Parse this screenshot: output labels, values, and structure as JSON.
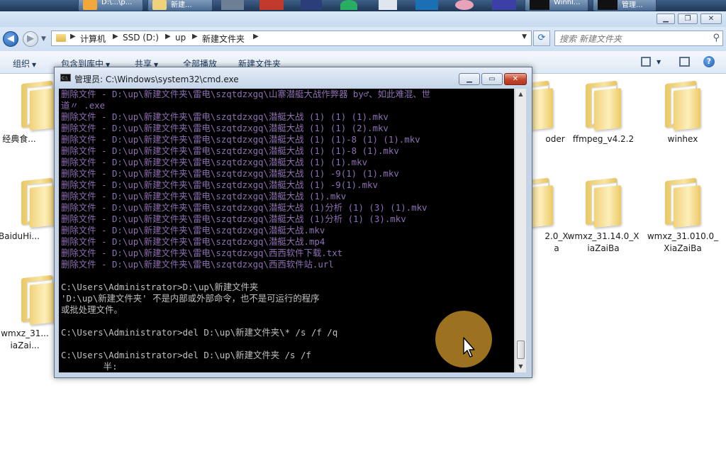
{
  "taskbar": {
    "items": [
      {
        "label": "D:\\...\\p...",
        "icon": "app-icon"
      },
      {
        "label": "新建...",
        "icon": "folder-icon"
      },
      {
        "label": "Winhl...",
        "icon": "window-icon"
      },
      {
        "label": "管理...",
        "icon": "cmd-icon"
      }
    ],
    "tray_icons": [
      "app-icon-1",
      "app-icon-2",
      "app-icon-3",
      "app-icon-4",
      "app-icon-5",
      "app-icon-6",
      "app-icon-7",
      "app-icon-8"
    ]
  },
  "explorer": {
    "breadcrumb": [
      "计算机",
      "SSD (D:)",
      "up",
      "新建文件夹"
    ],
    "search_placeholder": "搜索 新建文件夹",
    "toolbar": {
      "organize": "组织",
      "include_in_library": "包含到库中",
      "share": "共享",
      "play_all": "全部播放",
      "new_folder": "新建文件夹"
    },
    "folders": [
      {
        "label": "经典食..."
      },
      {
        "label": "BaiduHi..."
      },
      {
        "label": "wmxz_31...\niaZai..."
      },
      {
        "label": "oder"
      },
      {
        "label": "ffmpeg_v4.2.2"
      },
      {
        "label": "winhex"
      },
      {
        "label": "2.0_X\na"
      },
      {
        "label": "wmxz_31.14.0_X\niaZaiBa"
      },
      {
        "label": "wmxz_31.010.0_\nXiaZaiBa"
      }
    ]
  },
  "cmd": {
    "title": "管理员: C:\\Windows\\system32\\cmd.exe",
    "icon_text": "C:\\",
    "lines": [
      {
        "text": "删除文件 - D:\\up\\新建文件夹\\雷电\\szqtdzxgq\\山寨潜艇大战作弊器 by♂、如此难混、世",
        "type": "del"
      },
      {
        "text": "道〃 .exe",
        "type": "del"
      },
      {
        "text": "删除文件 - D:\\up\\新建文件夹\\雷电\\szqtdzxgq\\潜艇大战 (1) (1) (1).mkv",
        "type": "del"
      },
      {
        "text": "删除文件 - D:\\up\\新建文件夹\\雷电\\szqtdzxgq\\潜艇大战 (1) (1) (2).mkv",
        "type": "del"
      },
      {
        "text": "删除文件 - D:\\up\\新建文件夹\\雷电\\szqtdzxgq\\潜艇大战 (1) (1)-8 (1) (1).mkv",
        "type": "del"
      },
      {
        "text": "删除文件 - D:\\up\\新建文件夹\\雷电\\szqtdzxgq\\潜艇大战 (1) (1)-8 (1).mkv",
        "type": "del"
      },
      {
        "text": "删除文件 - D:\\up\\新建文件夹\\雷电\\szqtdzxgq\\潜艇大战 (1) (1).mkv",
        "type": "del"
      },
      {
        "text": "删除文件 - D:\\up\\新建文件夹\\雷电\\szqtdzxgq\\潜艇大战 (1) -9(1) (1).mkv",
        "type": "del"
      },
      {
        "text": "删除文件 - D:\\up\\新建文件夹\\雷电\\szqtdzxgq\\潜艇大战 (1) -9(1).mkv",
        "type": "del"
      },
      {
        "text": "删除文件 - D:\\up\\新建文件夹\\雷电\\szqtdzxgq\\潜艇大战 (1).mkv",
        "type": "del"
      },
      {
        "text": "删除文件 - D:\\up\\新建文件夹\\雷电\\szqtdzxgq\\潜艇大战 (1)分析 (1) (3) (1).mkv",
        "type": "del"
      },
      {
        "text": "删除文件 - D:\\up\\新建文件夹\\雷电\\szqtdzxgq\\潜艇大战 (1)分析 (1) (3).mkv",
        "type": "del"
      },
      {
        "text": "删除文件 - D:\\up\\新建文件夹\\雷电\\szqtdzxgq\\潜艇大战.mkv",
        "type": "del"
      },
      {
        "text": "删除文件 - D:\\up\\新建文件夹\\雷电\\szqtdzxgq\\潜艇大战.mp4",
        "type": "del"
      },
      {
        "text": "删除文件 - D:\\up\\新建文件夹\\雷电\\szqtdzxgq\\西西软件下载.txt",
        "type": "del"
      },
      {
        "text": "删除文件 - D:\\up\\新建文件夹\\雷电\\szqtdzxgq\\西西软件站.url",
        "type": "del"
      },
      {
        "text": "",
        "type": "out"
      },
      {
        "text": "C:\\Users\\Administrator>D:\\up\\新建文件夹",
        "type": "out"
      },
      {
        "text": "'D:\\up\\新建文件夹' 不是内部或外部命令，也不是可运行的程序",
        "type": "out"
      },
      {
        "text": "或批处理文件。",
        "type": "out"
      },
      {
        "text": "",
        "type": "out"
      },
      {
        "text": "C:\\Users\\Administrator>del D:\\up\\新建文件夹\\* /s /f /q",
        "type": "out"
      },
      {
        "text": "",
        "type": "out"
      },
      {
        "text": "C:\\Users\\Administrator>del D:\\up\\新建文件夹 /s /f",
        "type": "out"
      },
      {
        "text": "        半:",
        "type": "out"
      }
    ]
  },
  "colors": {
    "cmd_deleted_text": "#8e6fb4",
    "cmd_text": "#c0c0c0",
    "cursor_highlight": "#a97b22"
  }
}
